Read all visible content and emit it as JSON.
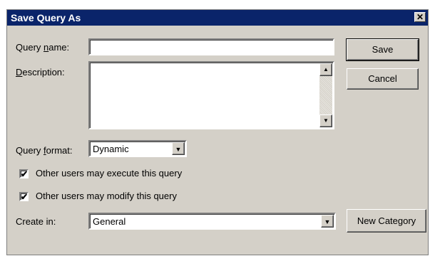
{
  "dialog": {
    "title": "Save Query As",
    "close_glyph": "✕"
  },
  "query_name": {
    "label_pre": "Query ",
    "label_ul": "n",
    "label_post": "ame:",
    "value": ""
  },
  "description": {
    "label_ul": "D",
    "label_post": "escription:",
    "value": ""
  },
  "query_format": {
    "label_pre": "Query ",
    "label_ul": "f",
    "label_post": "ormat:",
    "value": "Dynamic"
  },
  "options": [
    {
      "label": "Other users may execute this query",
      "checked": true
    },
    {
      "label": "Other users may modify this query",
      "checked": true
    }
  ],
  "create_in": {
    "label": "Create in:",
    "value": "General"
  },
  "buttons": {
    "save": "Save",
    "cancel": "Cancel",
    "new_category": "New Category"
  },
  "glyphs": {
    "check": "✔",
    "up": "▲",
    "down": "▼"
  },
  "colors": {
    "titlebar": "#0a246a",
    "face": "#d4d0c8"
  }
}
